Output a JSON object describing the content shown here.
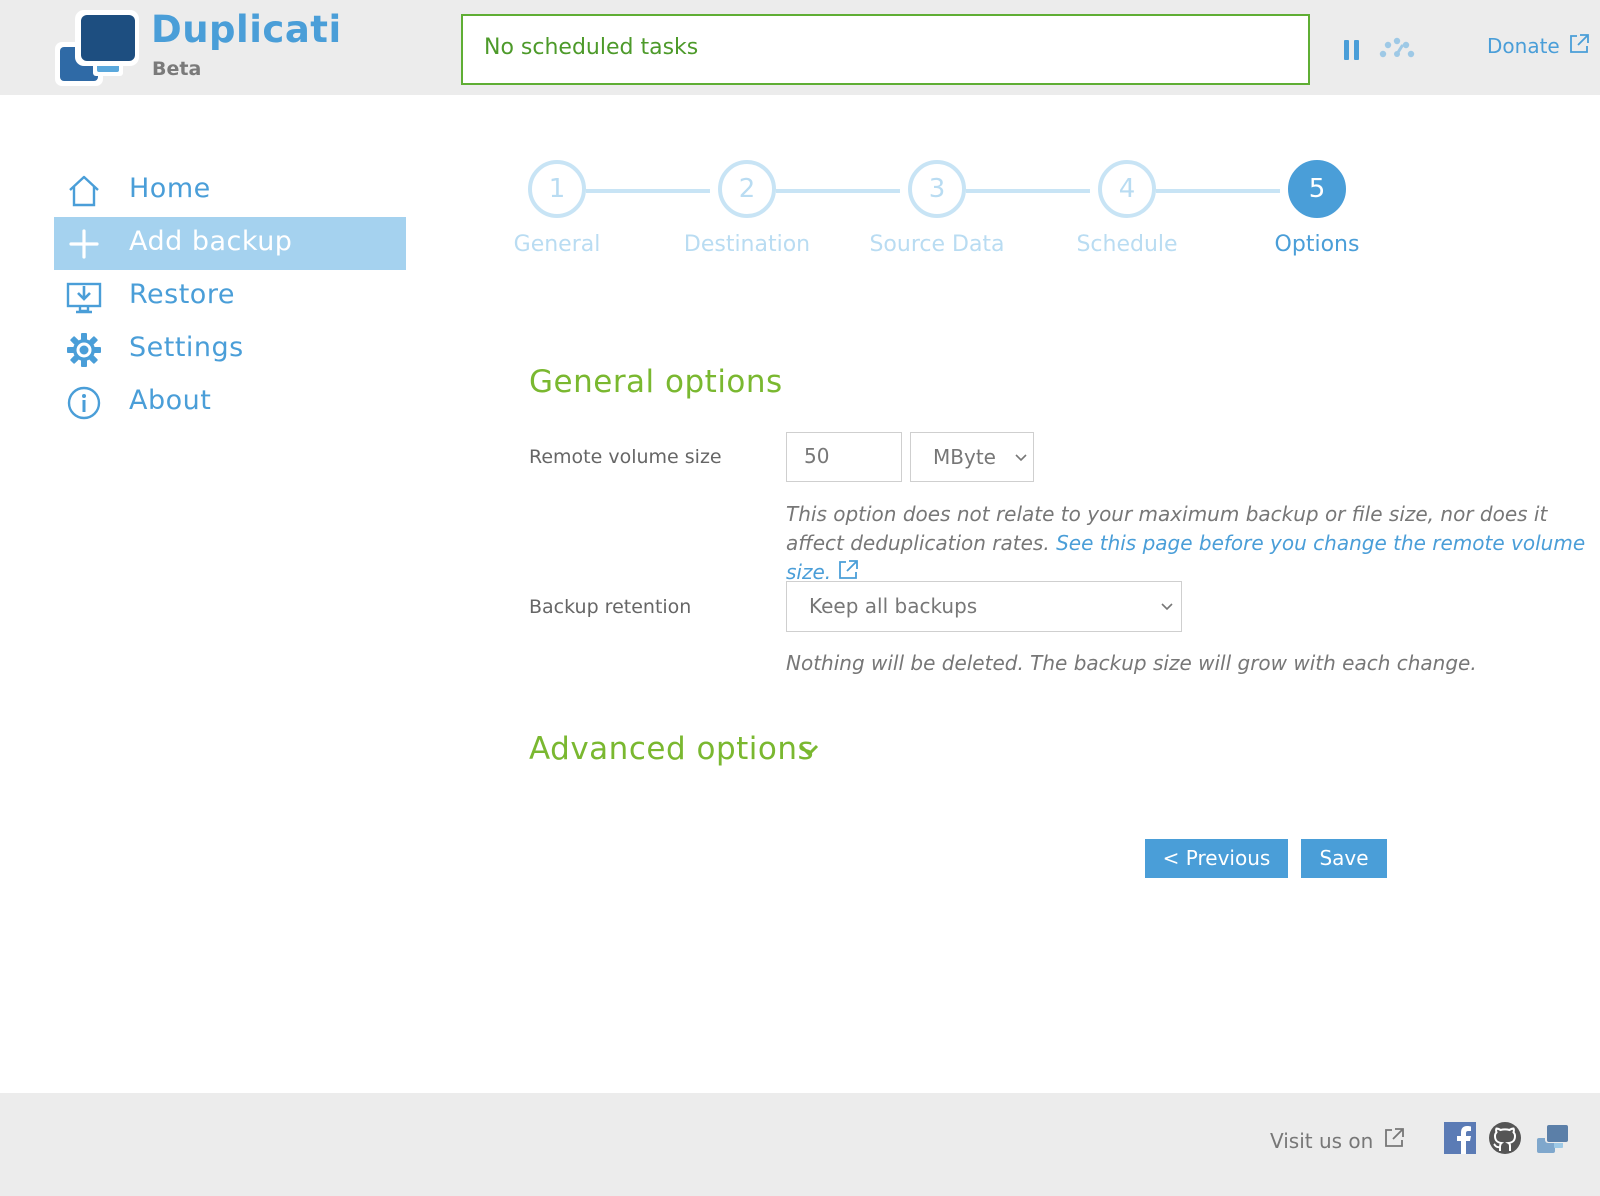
{
  "header": {
    "brand_title": "Duplicati",
    "brand_subtitle": "Beta",
    "status_text": "No scheduled tasks",
    "donate_label": "Donate"
  },
  "sidebar": {
    "items": [
      {
        "label": "Home",
        "icon": "home-icon",
        "active": false
      },
      {
        "label": "Add backup",
        "icon": "plus-icon",
        "active": true
      },
      {
        "label": "Restore",
        "icon": "restore-icon",
        "active": false
      },
      {
        "label": "Settings",
        "icon": "gear-icon",
        "active": false
      },
      {
        "label": "About",
        "icon": "info-icon",
        "active": false
      }
    ]
  },
  "stepper": {
    "steps": [
      {
        "number": "1",
        "label": "General"
      },
      {
        "number": "2",
        "label": "Destination"
      },
      {
        "number": "3",
        "label": "Source Data"
      },
      {
        "number": "4",
        "label": "Schedule"
      },
      {
        "number": "5",
        "label": "Options"
      }
    ],
    "current_step": 5
  },
  "general_options": {
    "title": "General options",
    "remote_volume": {
      "label": "Remote volume size",
      "value": "50",
      "unit": "MByte",
      "help_text": "This option does not relate to your maximum backup or file size, nor does it affect deduplication rates.",
      "help_link": "See this page before you change the remote volume size."
    },
    "retention": {
      "label": "Backup retention",
      "value": "Keep all backups",
      "help_text": "Nothing will be deleted. The backup size will grow with each change."
    }
  },
  "advanced_options": {
    "title": "Advanced options"
  },
  "buttons": {
    "previous": "< Previous",
    "save": "Save"
  },
  "footer": {
    "visit_text": "Visit us on",
    "social": [
      "facebook-icon",
      "github-icon",
      "duplicati-forum-icon"
    ]
  },
  "colors": {
    "accent_blue": "#4a9ed8",
    "accent_green": "#7ab830",
    "active_nav": "#a5d2ef",
    "header_bg": "#ececec"
  }
}
